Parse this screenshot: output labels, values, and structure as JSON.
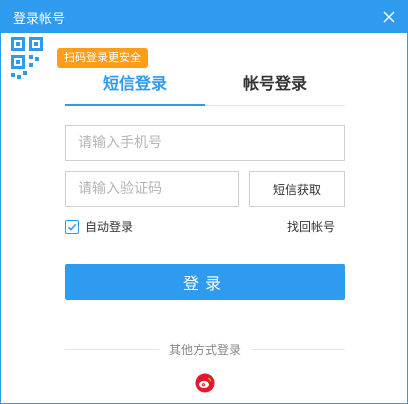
{
  "window": {
    "title": "登录帐号"
  },
  "qr": {
    "tip": "扫码登录更安全"
  },
  "tabs": [
    {
      "label": "短信登录",
      "active": true
    },
    {
      "label": "帐号登录",
      "active": false
    }
  ],
  "form": {
    "phone_placeholder": "请输入手机号",
    "code_placeholder": "请输入验证码",
    "get_code_label": "短信获取",
    "auto_login_label": "自动登录",
    "auto_login_checked": true,
    "find_account_label": "找回帐号",
    "submit_label": "登录"
  },
  "other": {
    "label": "其他方式登录",
    "icons": [
      "weibo-icon"
    ]
  },
  "colors": {
    "accent": "#2f9bef",
    "tip": "#ff9c1a",
    "weibo": "#e6162d"
  }
}
